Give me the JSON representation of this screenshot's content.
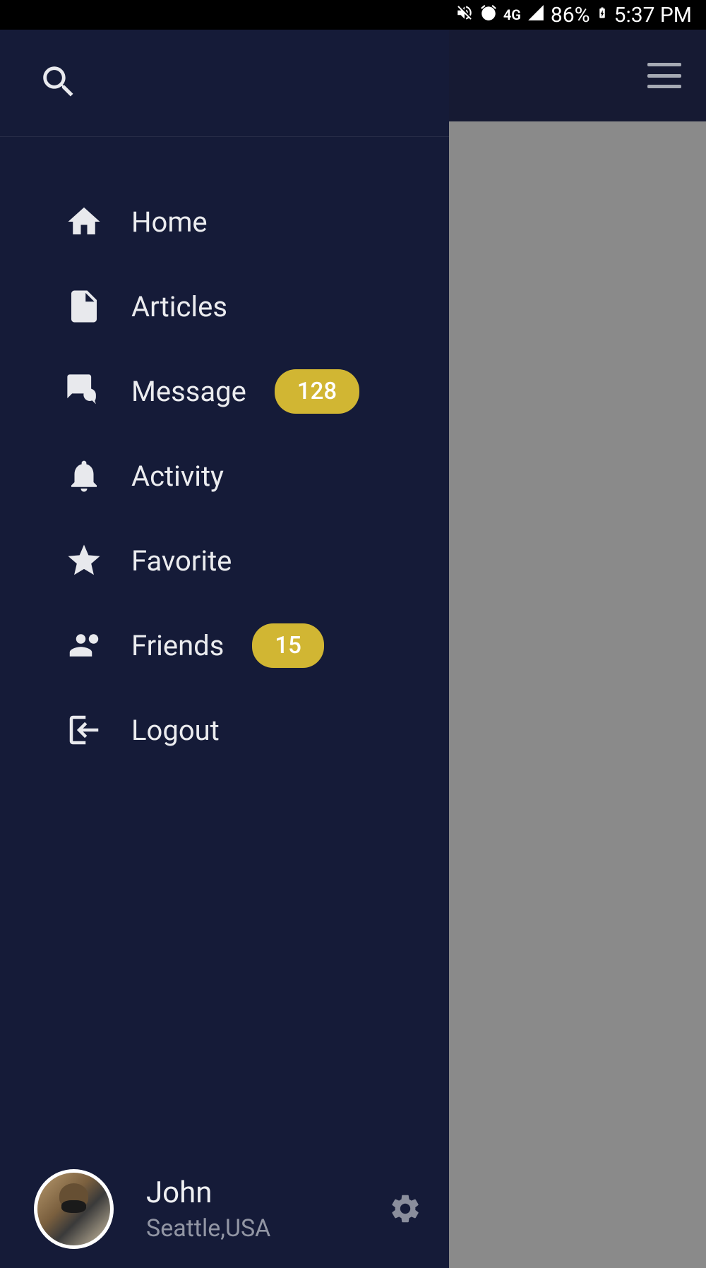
{
  "status": {
    "network": "4G",
    "battery_pct": "86%",
    "time": "5:37 PM"
  },
  "menu": {
    "items": [
      {
        "label": "Home",
        "badge": null
      },
      {
        "label": "Articles",
        "badge": null
      },
      {
        "label": "Message",
        "badge": "128"
      },
      {
        "label": "Activity",
        "badge": null
      },
      {
        "label": "Favorite",
        "badge": null
      },
      {
        "label": "Friends",
        "badge": "15"
      },
      {
        "label": "Logout",
        "badge": null
      }
    ]
  },
  "profile": {
    "name": "John",
    "location": "Seattle,USA"
  },
  "colors": {
    "drawer_bg": "#151b38",
    "badge_bg": "#d1b633"
  }
}
